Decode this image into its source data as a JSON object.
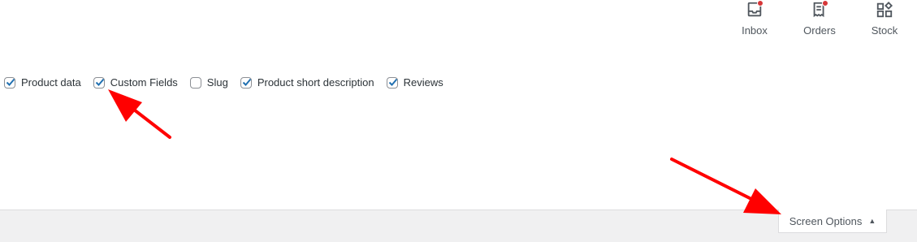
{
  "activity_panel": {
    "tabs": [
      {
        "label": "Inbox",
        "icon": "inbox-icon",
        "has_notification": true
      },
      {
        "label": "Orders",
        "icon": "orders-icon",
        "has_notification": true
      },
      {
        "label": "Stock",
        "icon": "stock-icon",
        "has_notification": false
      }
    ]
  },
  "screen_options": {
    "checkboxes": [
      {
        "label": "Product data",
        "checked": true
      },
      {
        "label": "Custom Fields",
        "checked": true
      },
      {
        "label": "Slug",
        "checked": false
      },
      {
        "label": "Product short description",
        "checked": true
      },
      {
        "label": "Reviews",
        "checked": true
      }
    ],
    "toggle_label": "Screen Options",
    "toggle_icon": "caret-up-icon"
  },
  "colors": {
    "accent": "#2271b1",
    "notification": "#d63638",
    "annotation": "#ff0000",
    "bar_background": "#f0f0f1"
  }
}
